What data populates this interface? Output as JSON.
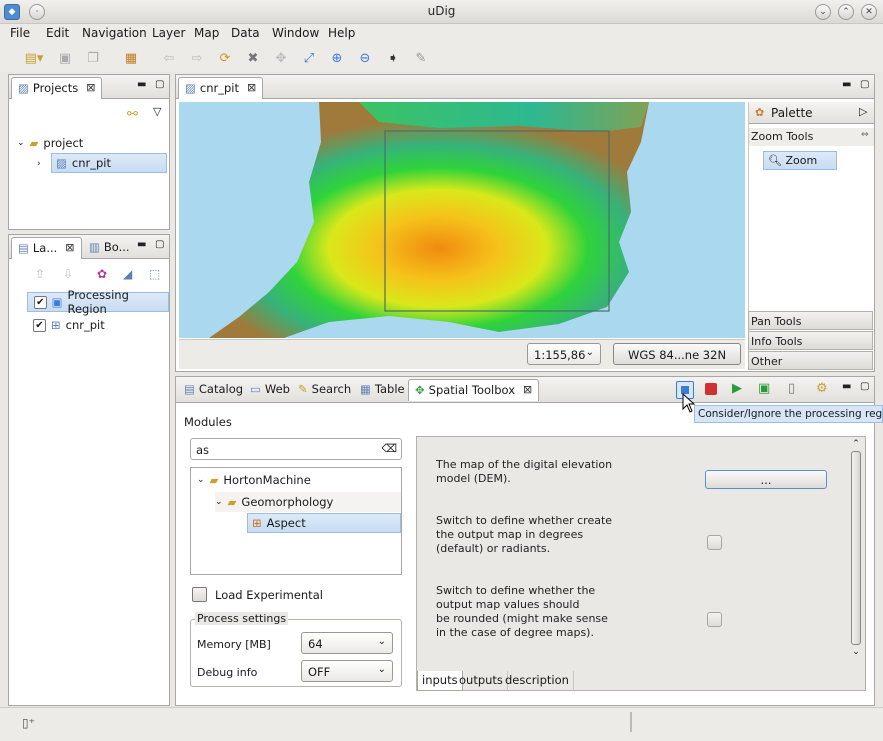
{
  "window": {
    "title": "uDig"
  },
  "menu": [
    "File",
    "Edit",
    "Navigation",
    "Layer",
    "Map",
    "Data",
    "Window",
    "Help"
  ],
  "projects": {
    "tab_label": "Projects",
    "tree": {
      "root": "project",
      "child": "cnr_pit"
    }
  },
  "layers": {
    "tab_label": "La...",
    "tab2_label": "Bo...",
    "items": [
      {
        "label": "Processing Region",
        "checked": true
      },
      {
        "label": "cnr_pit",
        "checked": true
      }
    ]
  },
  "map": {
    "tab_label": "cnr_pit",
    "scale": "1:155,86",
    "crs": "WGS 84...ne 32N"
  },
  "palette": {
    "title": "Palette",
    "zoom_tools_label": "Zoom Tools",
    "zoom_item": "Zoom",
    "drawers": [
      "Pan Tools",
      "Info Tools",
      "Other"
    ]
  },
  "bottom_tabs": [
    "Catalog",
    "Web",
    "Search",
    "Table",
    "Spatial Toolbox"
  ],
  "tooltip": "Consider/Ignore the processing region",
  "toolbox": {
    "modules_label": "Modules",
    "search_value": "as",
    "tree": [
      "HortonMachine",
      "Geomorphology",
      "Aspect"
    ],
    "load_experimental": "Load Experimental",
    "process_settings": "Process settings",
    "memory_label": "Memory [MB]",
    "memory_value": "64",
    "debug_label": "Debug info",
    "debug_value": "OFF",
    "params": [
      {
        "desc": [
          "The map of the digital elevation",
          "model (DEM)."
        ],
        "control": "..."
      },
      {
        "desc": [
          "Switch to define whether create",
          "the output map in degrees",
          "(default) or radiants."
        ]
      },
      {
        "desc": [
          "Switch to define whether the",
          "output map values should",
          "be rounded (might make sense",
          "in the case of degree maps)."
        ]
      }
    ],
    "subtabs": [
      "inputs",
      "outputs",
      "description"
    ]
  },
  "colors": {
    "selection": "#c8dcf3",
    "sea": "#a9d8ef",
    "accent": "#3a7bd5"
  }
}
